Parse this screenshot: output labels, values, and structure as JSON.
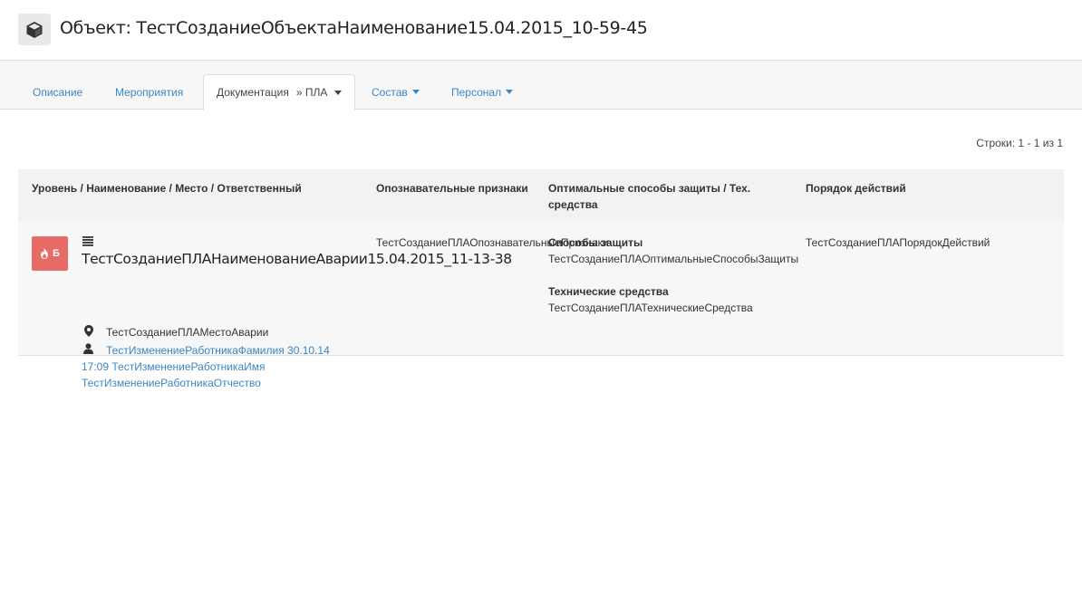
{
  "header": {
    "title": "Объект: ТестСозданиеОбъектаНаименование15.04.2015_10-59-45",
    "icon": "cube-icon"
  },
  "tabs": [
    {
      "label": "Описание",
      "active": false,
      "dropdown": false
    },
    {
      "label": "Мероприятия",
      "active": false,
      "dropdown": false
    },
    {
      "label": "Документация",
      "sub": "» ПЛА",
      "active": true,
      "dropdown": true
    },
    {
      "label": "Состав",
      "active": false,
      "dropdown": true
    },
    {
      "label": "Персонал",
      "active": false,
      "dropdown": true
    }
  ],
  "rows_info": "Строки: 1 - 1 из 1",
  "table": {
    "columns": [
      "Уровень / Наименование / Место / Ответственный",
      "Опознавательные признаки",
      "Оптимальные способы защиты / Тех. средства",
      "Порядок действий"
    ],
    "rows": [
      {
        "level_badge": "Б",
        "level_icon": "fire-icon",
        "name": "ТестСозданиеПЛАНаименованиеАварии15.04.2015_11-13-38",
        "place": "ТестСозданиеПЛАМестоАварии",
        "responsible": "ТестИзменениеРаботникаФамилия 30.10.14 17:09 ТестИзменениеРаботникаИмя ТестИзменениеРаботникаОтчество",
        "signs": "ТестСозданиеПЛАОпознавательныеПризнаки",
        "protection_heading": "Способы защиты",
        "protection": "ТестСозданиеПЛАОптимальныеСпособыЗащиты",
        "tech_heading": "Технические средства",
        "tech": "ТестСозданиеПЛАТехническиеСредства",
        "procedure": "ТестСозданиеПЛАПорядокДействий"
      }
    ]
  },
  "colors": {
    "link": "#3a87c5",
    "badge": "#e66a66",
    "header_bg": "#f2f2f2",
    "row_bg": "#f7f7f7"
  }
}
